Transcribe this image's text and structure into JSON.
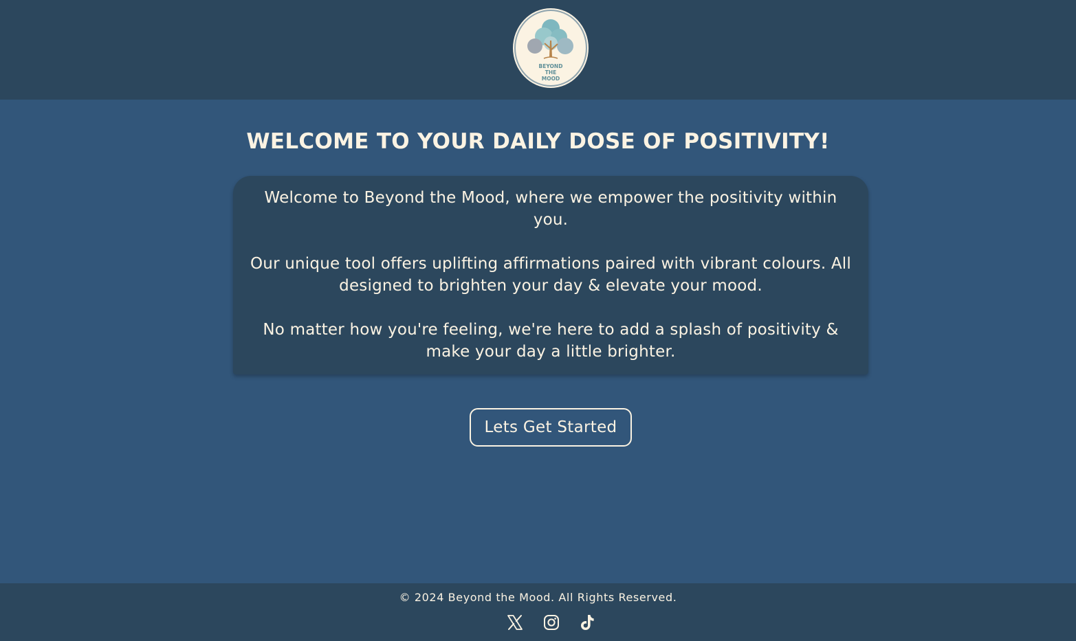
{
  "brand": {
    "logo_icon": "tree-logo",
    "logo_text_lines": [
      "BEYOND",
      "THE",
      "MOOD"
    ]
  },
  "main": {
    "title": "WELCOME TO YOUR DAILY DOSE OF POSITIVITY!",
    "paragraphs": [
      "Welcome to Beyond the Mood, where we empower the positivity within you.",
      "Our unique tool offers uplifting affirmations paired with vibrant colours. All designed to brighten your day & elevate your mood.",
      "No matter how you're feeling, we're here to add a splash of positivity & make your day a little brighter."
    ],
    "cta_label": "Lets Get Started"
  },
  "footer": {
    "copyright": "© 2024 Beyond the Mood. All Rights Reserved.",
    "social_icons": [
      "x-icon",
      "instagram-icon",
      "tiktok-icon"
    ]
  },
  "colors": {
    "header_bg": "#2c475d",
    "page_bg": "#32567a",
    "card_bg": "#2c475d",
    "text": "#fbf3e3"
  }
}
